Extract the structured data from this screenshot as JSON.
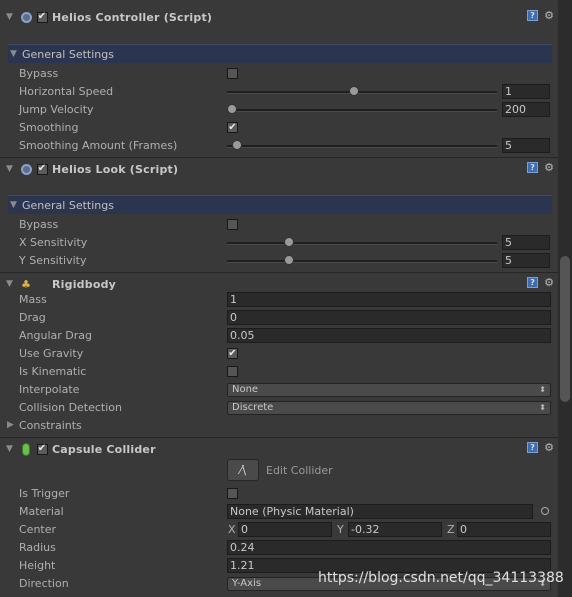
{
  "helios_controller": {
    "title": "Helios Controller (Script)",
    "section": "General Settings",
    "bypass_label": "Bypass",
    "horizontal_speed_label": "Horizontal Speed",
    "horizontal_speed_value": "1",
    "horizontal_speed_fraction": 0.47,
    "jump_velocity_label": "Jump Velocity",
    "jump_velocity_value": "200",
    "jump_velocity_fraction": 0.0,
    "smoothing_label": "Smoothing",
    "smoothing_checked": true,
    "smoothing_amount_label": "Smoothing Amount (Frames)",
    "smoothing_amount_value": "5",
    "smoothing_amount_fraction": 0.02
  },
  "helios_look": {
    "title": "Helios Look (Script)",
    "section": "General Settings",
    "bypass_label": "Bypass",
    "x_sensitivity_label": "X Sensitivity",
    "x_sensitivity_value": "5",
    "x_sensitivity_fraction": 0.22,
    "y_sensitivity_label": "Y Sensitivity",
    "y_sensitivity_value": "5",
    "y_sensitivity_fraction": 0.22
  },
  "rigidbody": {
    "title": "Rigidbody",
    "mass_label": "Mass",
    "mass_value": "1",
    "drag_label": "Drag",
    "drag_value": "0",
    "angular_drag_label": "Angular Drag",
    "angular_drag_value": "0.05",
    "use_gravity_label": "Use Gravity",
    "is_kinematic_label": "Is Kinematic",
    "interpolate_label": "Interpolate",
    "interpolate_value": "None",
    "collision_detection_label": "Collision Detection",
    "collision_detection_value": "Discrete",
    "constraints_label": "Constraints"
  },
  "capsule_collider": {
    "title": "Capsule Collider",
    "edit_collider_label": "Edit Collider",
    "is_trigger_label": "Is Trigger",
    "material_label": "Material",
    "material_value": "None (Physic Material)",
    "center_label": "Center",
    "center_x_label": "X",
    "center_x": "0",
    "center_y_label": "Y",
    "center_y": "-0.32",
    "center_z_label": "Z",
    "center_z": "0",
    "radius_label": "Radius",
    "radius_value": "0.24",
    "height_label": "Height",
    "height_value": "1.21",
    "direction_label": "Direction",
    "direction_value": "Y-Axis"
  },
  "watermark": "https://blog.csdn.net/qq_34113388"
}
